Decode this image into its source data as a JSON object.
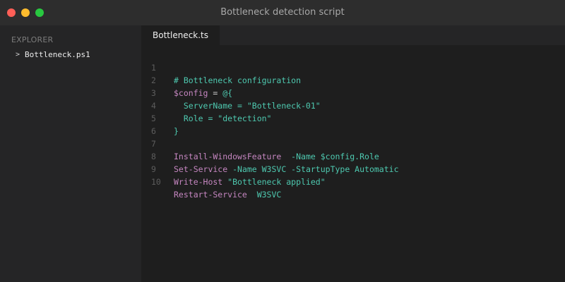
{
  "window": {
    "title": "Bottleneck detection script"
  },
  "sidebar": {
    "section_label": "EXPLORER",
    "files": [
      {
        "chevron": ">",
        "name": "Bottleneck.ps1"
      }
    ]
  },
  "editor": {
    "tab_label": "Bottleneck.ts",
    "lines": [
      {
        "n": "1",
        "parts": [
          {
            "t": "# Bottleneck configuration"
          }
        ]
      },
      {
        "n": "2",
        "parts": [
          {
            "t": "$config"
          },
          {
            "t": " = "
          },
          {
            "t": "@{"
          }
        ]
      },
      {
        "n": "3",
        "parts": [
          {
            "t": "  ServerName = \"Bottleneck-01\""
          }
        ]
      },
      {
        "n": "4",
        "parts": [
          {
            "t": "  Role = \"detection\""
          }
        ]
      },
      {
        "n": "5",
        "parts": [
          {
            "t": "}"
          }
        ]
      },
      {
        "n": "6",
        "parts": []
      },
      {
        "n": "7",
        "parts": [
          {
            "t": "Install-WindowsFeature"
          },
          {
            "t": "  -Name $config.Role"
          }
        ]
      },
      {
        "n": "8",
        "parts": [
          {
            "t": "Set-Service"
          },
          {
            "t": " -Name W3SVC -StartupType Automatic"
          }
        ]
      },
      {
        "n": "9",
        "parts": [
          {
            "t": "Write-Host"
          },
          {
            "t": " \"Bottleneck applied\""
          }
        ]
      },
      {
        "n": "10",
        "parts": [
          {
            "t": "Restart-Service"
          },
          {
            "t": "  W3SVC"
          }
        ]
      }
    ]
  },
  "colors": {
    "traffic_close": "#ff5f57",
    "traffic_minimize": "#febc2e",
    "traffic_maximize": "#28c840",
    "keyword_purple": "#c586c0",
    "string_teal": "#4ec9b0"
  }
}
